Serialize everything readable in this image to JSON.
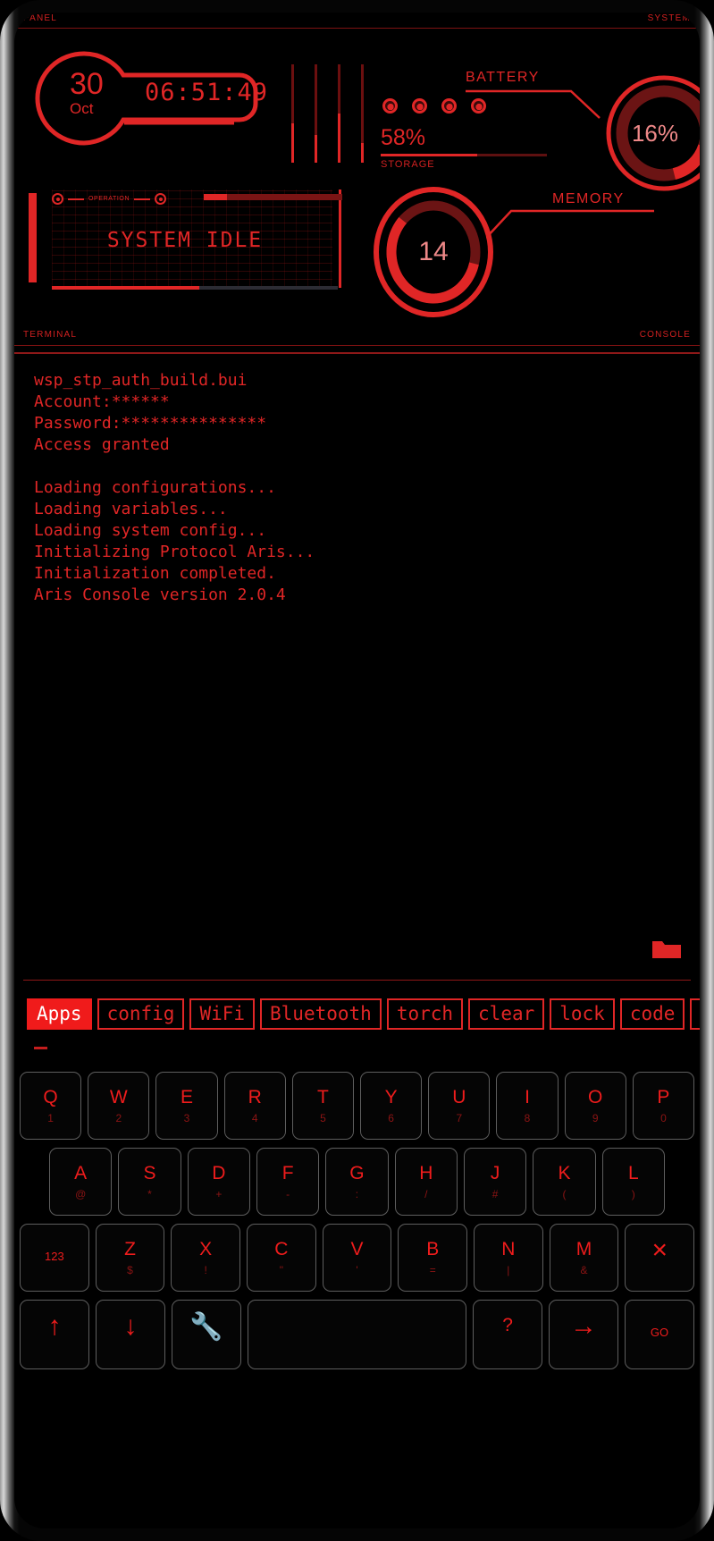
{
  "status_strip": {
    "left": "PANEL",
    "right": "SYSTEM"
  },
  "clock": {
    "day": "30",
    "month": "Oct",
    "time": "06:51:49"
  },
  "storage": {
    "percent": "58%",
    "label": "STORAGE",
    "fill_pct": 58
  },
  "battery": {
    "label": "BATTERY",
    "value": "16%",
    "fill_pct": 16
  },
  "memory": {
    "label": "MEMORY",
    "value": "14",
    "fill_pct": 14
  },
  "operation": {
    "tag": "OPERATION",
    "state": "SYSTEM IDLE"
  },
  "terminal_strip": {
    "left": "TERMINAL",
    "right": "CONSOLE"
  },
  "console_lines": [
    "wsp_stp_auth_build.bui",
    "Account:******",
    "Password:***************",
    "Access granted",
    "",
    "Loading configurations...",
    "Loading variables...",
    "Loading system config...",
    "Initializing Protocol Aris...",
    "Initialization completed.",
    "Aris Console version 2.0.4"
  ],
  "chips": [
    {
      "label": "Apps",
      "active": true
    },
    {
      "label": "config",
      "active": false
    },
    {
      "label": "WiFi",
      "active": false
    },
    {
      "label": "Bluetooth",
      "active": false
    },
    {
      "label": "torch",
      "active": false
    },
    {
      "label": "clear",
      "active": false
    },
    {
      "label": "lock",
      "active": false
    },
    {
      "label": "code",
      "active": false
    },
    {
      "label": "[",
      "active": false
    }
  ],
  "keyboard": {
    "row1": [
      {
        "cap": "Q",
        "sub": "1"
      },
      {
        "cap": "W",
        "sub": "2"
      },
      {
        "cap": "E",
        "sub": "3"
      },
      {
        "cap": "R",
        "sub": "4"
      },
      {
        "cap": "T",
        "sub": "5"
      },
      {
        "cap": "Y",
        "sub": "6"
      },
      {
        "cap": "U",
        "sub": "7"
      },
      {
        "cap": "I",
        "sub": "8"
      },
      {
        "cap": "O",
        "sub": "9"
      },
      {
        "cap": "P",
        "sub": "0"
      }
    ],
    "row2": [
      {
        "cap": "A",
        "sub": "@"
      },
      {
        "cap": "S",
        "sub": "*"
      },
      {
        "cap": "D",
        "sub": "+"
      },
      {
        "cap": "F",
        "sub": "-"
      },
      {
        "cap": "G",
        "sub": ":"
      },
      {
        "cap": "H",
        "sub": "/"
      },
      {
        "cap": "J",
        "sub": "#"
      },
      {
        "cap": "K",
        "sub": "("
      },
      {
        "cap": "L",
        "sub": ")"
      }
    ],
    "row3": [
      {
        "cap": "123",
        "sub": ""
      },
      {
        "cap": "Z",
        "sub": "$"
      },
      {
        "cap": "X",
        "sub": "!"
      },
      {
        "cap": "C",
        "sub": "\""
      },
      {
        "cap": "V",
        "sub": "'"
      },
      {
        "cap": "B",
        "sub": "="
      },
      {
        "cap": "N",
        "sub": "|"
      },
      {
        "cap": "M",
        "sub": "&"
      },
      {
        "cap": "×",
        "sub": ""
      }
    ],
    "row4": [
      {
        "cap": "↑",
        "sub": ""
      },
      {
        "cap": "↓",
        "sub": ""
      },
      {
        "cap": "🔧",
        "sub": ""
      },
      {
        "cap": "",
        "sub": ""
      },
      {
        "cap": "?",
        "sub": ""
      },
      {
        "cap": "→",
        "sub": ""
      },
      {
        "cap": "GO",
        "sub": ""
      }
    ]
  },
  "colors": {
    "accent": "#e02626",
    "accent_bright": "#f01b1b",
    "dim": "#7e1212"
  }
}
